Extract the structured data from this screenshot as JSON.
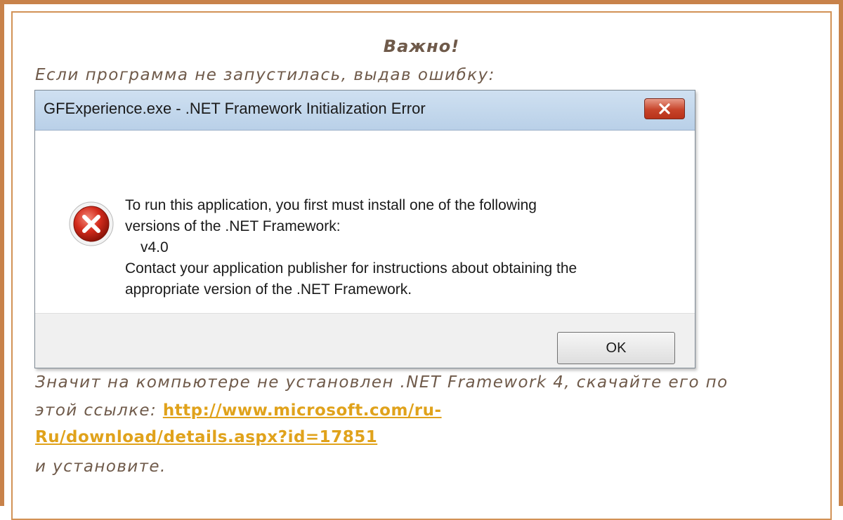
{
  "notice": {
    "title": "Важно!",
    "intro": "Если программа не запустилась, выдав ошибку:",
    "explanation": "Значит на компьютере не установлен .NET Framework 4, скачайте его по",
    "link_prefix": "этой ссылке: ",
    "link_line1": "http://www.microsoft.com/ru-",
    "link_line2": "Ru/download/details.aspx?id=17851",
    "closing": " и установите."
  },
  "dialog": {
    "title": "GFExperience.exe - .NET Framework Initialization Error",
    "icon": "error-icon",
    "message_lines": [
      "To run this application, you first must install one of the following",
      "versions of the .NET Framework:",
      "v4.0",
      "Contact your application publisher for instructions about obtaining the",
      "appropriate version of the .NET Framework."
    ],
    "ok_label": "OK"
  },
  "colors": {
    "frame": "#c8824a",
    "text": "#6f5a4a",
    "link": "#e0a21b"
  }
}
